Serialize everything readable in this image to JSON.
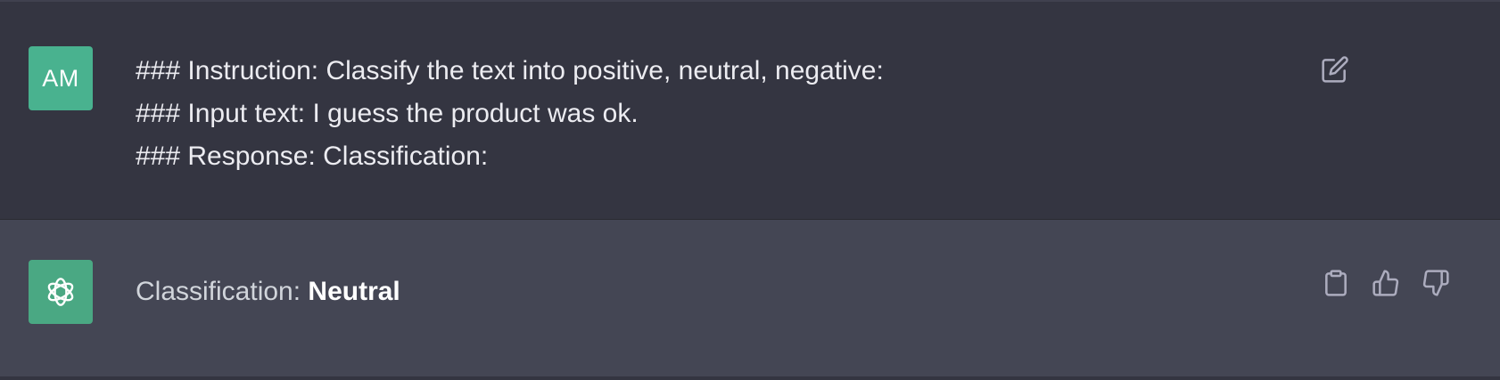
{
  "user_message": {
    "avatar_initials": "AM",
    "avatar_color": "#49b28f",
    "lines": [
      "### Instruction: Classify the text into positive, neutral, negative:",
      "### Input text: I guess the product was ok.",
      "### Response: Classification:"
    ],
    "actions": {
      "edit_icon": "edit-icon"
    }
  },
  "assistant_message": {
    "avatar_icon": "openai-logo-icon",
    "avatar_color": "#4aa883",
    "label": "Classification:",
    "value": "Neutral",
    "actions": {
      "copy_icon": "clipboard-icon",
      "like_icon": "thumbs-up-icon",
      "dislike_icon": "thumbs-down-icon"
    }
  },
  "colors": {
    "user_background": "#343541",
    "assistant_background": "#444654",
    "icon_color": "#acacbe"
  }
}
